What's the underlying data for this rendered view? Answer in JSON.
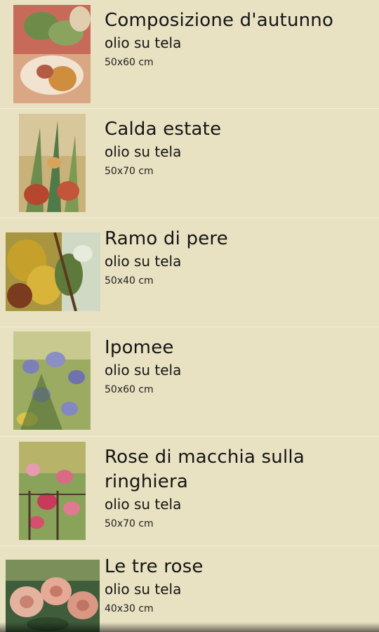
{
  "artworks": [
    {
      "title": "Composizione d'autunno",
      "medium": "olio su tela",
      "size": "50x60 cm",
      "thumb": "autumn-composition-painting"
    },
    {
      "title": "Calda estate",
      "medium": "olio su tela",
      "size": "50x70 cm",
      "thumb": "hot-summer-painting"
    },
    {
      "title": "Ramo di pere",
      "medium": "olio su tela",
      "size": "50x40 cm",
      "thumb": "pear-branch-painting"
    },
    {
      "title": "Ipomee",
      "medium": "olio su tela",
      "size": "50x60 cm",
      "thumb": "morning-glory-painting"
    },
    {
      "title": "Rose di macchia sulla ringhiera",
      "medium": "olio su tela",
      "size": "50x70 cm",
      "thumb": "wild-roses-painting"
    },
    {
      "title": "Le tre rose",
      "medium": "olio su tela",
      "size": "40x30 cm",
      "thumb": "three-roses-painting"
    }
  ]
}
